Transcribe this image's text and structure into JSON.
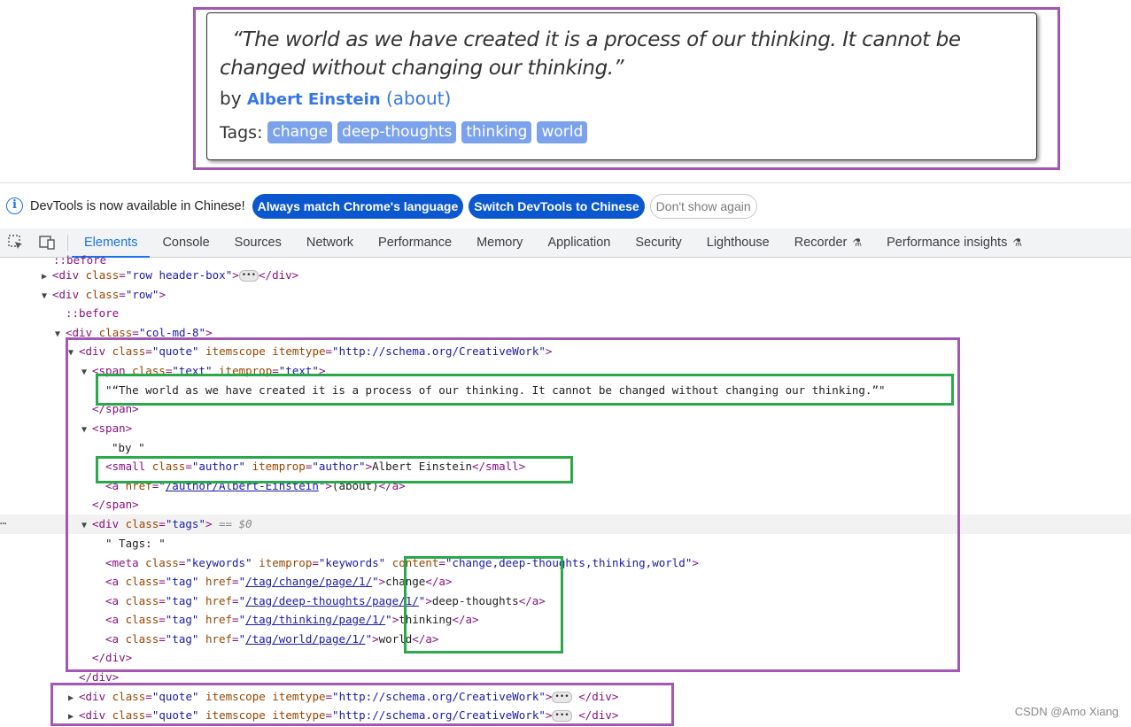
{
  "quote": {
    "text": "“The world as we have created it is a process of our thinking. It cannot be changed without changing our thinking.”",
    "by_label": "by",
    "author": "Albert Einstein",
    "about_link": "(about)",
    "tags_label": "Tags:",
    "tags": [
      "change",
      "deep-thoughts",
      "thinking",
      "world"
    ]
  },
  "infobar": {
    "message": "DevTools is now available in Chinese!",
    "btn_match": "Always match Chrome's language",
    "btn_switch": "Switch DevTools to Chinese",
    "btn_dismiss": "Don't show again"
  },
  "tabs": [
    "Elements",
    "Console",
    "Sources",
    "Network",
    "Performance",
    "Memory",
    "Application",
    "Security",
    "Lighthouse",
    "Recorder",
    "Performance insights"
  ],
  "active_tab": "Elements",
  "icons": {
    "inspect": "inspect-element-icon",
    "device": "device-toolbar-icon",
    "info": "info-icon",
    "flask": "experimental-flask-icon"
  },
  "dom": {
    "l0": "::before",
    "l1_tag_open": "<div",
    "l1_attr_class": "class",
    "l1_val_class": "\"row header-box\"",
    "l1_close": "</div>",
    "l2_tag": "<div",
    "l2_val": "\"row\"",
    "l3_pseudo": "::before",
    "l4_val": "\"col-md-8\"",
    "l5_val_class": "\"quote\"",
    "l5_itemscope": "itemscope",
    "l5_itemtype": "itemtype",
    "l5_val_type": "\"http://schema.org/CreativeWork\"",
    "l6_tag": "<span",
    "l6_val_class": "\"text\"",
    "l6_itemprop": "itemprop",
    "l6_val_prop": "\"text\"",
    "l7_text": "\"“The world as we have created it is a process of our thinking. It cannot be changed without changing our thinking.”\"",
    "l8_close": "</span>",
    "l9_tag": "<span>",
    "l10_text": "\"by \"",
    "l11_tag": "<small",
    "l11_val_class": "\"author\"",
    "l11_val_prop": "\"author\"",
    "l11_text": "Albert Einstein",
    "l11_close": "</small>",
    "l12_tag": "<a",
    "l12_href": "href",
    "l12_link": "/author/Albert-Einstein",
    "l12_text": "(about)",
    "l12_close": "</a>",
    "l13_close": "</span>",
    "l14_val_class": "\"tags\"",
    "l14_eq": "== $0",
    "l15_text": "\" Tags: \"",
    "l16_tag": "<meta",
    "l16_val_class": "\"keywords\"",
    "l16_val_prop": "\"keywords\"",
    "l16_content": "content",
    "l16_val_content": "\"change,deep-thoughts,thinking,world\"",
    "tag_rows": [
      {
        "href": "/tag/change/page/1/",
        "text": "change"
      },
      {
        "href": "/tag/deep-thoughts/page/1/",
        "text": "deep-thoughts"
      },
      {
        "href": "/tag/thinking/page/1/",
        "text": "thinking"
      },
      {
        "href": "/tag/world/page/1/",
        "text": "world"
      }
    ],
    "tag_val_class": "\"tag\"",
    "close_div": "</div>"
  },
  "watermark": "CSDN @Amo Xiang"
}
